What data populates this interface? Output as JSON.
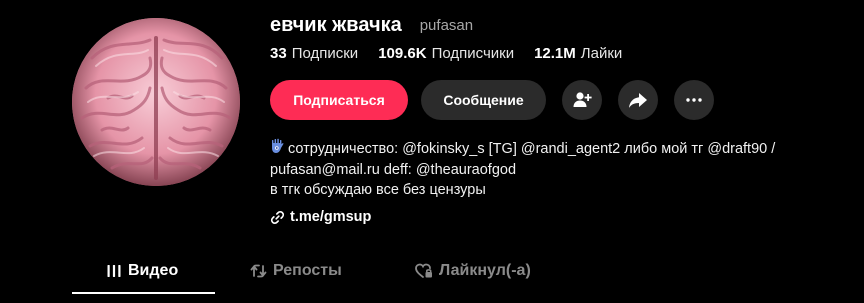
{
  "profile": {
    "display_name": "евчик жвачка",
    "username": "pufasan"
  },
  "stats": {
    "following_count": "33",
    "following_label": "Подписки",
    "followers_count": "109.6K",
    "followers_label": "Подписчики",
    "likes_count": "12.1M",
    "likes_label": "Лайки"
  },
  "actions": {
    "follow_label": "Подписаться",
    "message_label": "Сообщение",
    "add_friend_icon": "add-person-icon",
    "share_icon": "share-arrow-icon",
    "more_icon": "more-dots-icon"
  },
  "bio": {
    "line1": "сотрудничество: @fokinsky_s [TG] @randi_agent2 либо мой тг @draft90 /",
    "line2": "pufasan@mail.ru deff: @theauraofgod",
    "line3": "в тгк обсуждаю все без цензуры"
  },
  "link": {
    "text": "t.me/gmsup"
  },
  "tabs": {
    "videos": "Видео",
    "reposts": "Репосты",
    "liked": "Лайкнул(-а)"
  },
  "colors": {
    "background": "#000000",
    "accent": "#fe2c55",
    "secondary_button": "#2b2b2b",
    "muted_text": "#8a8a8a"
  }
}
